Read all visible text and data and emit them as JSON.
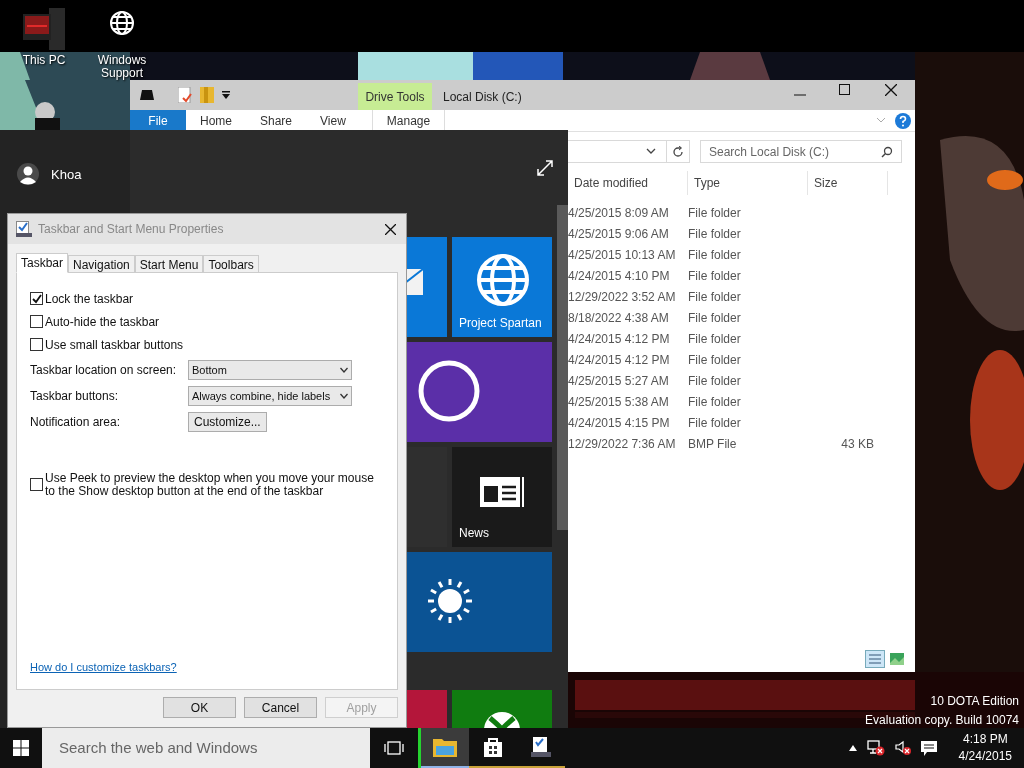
{
  "desktop_icons": [
    {
      "kind": "computer",
      "label": "This PC"
    },
    {
      "kind": "globe",
      "label": "Windows Support"
    }
  ],
  "explorer": {
    "context_tab": "Drive Tools",
    "title": "Local Disk (C:)",
    "ribbon_tabs": [
      {
        "label": "File",
        "selected": true
      },
      {
        "label": "Home",
        "selected": false
      },
      {
        "label": "Share",
        "selected": false
      },
      {
        "label": "View",
        "selected": false
      },
      {
        "label": "Manage",
        "selected": false
      }
    ],
    "search": {
      "placeholder": "Search Local Disk (C:)"
    },
    "columns": [
      "Date modified",
      "Type",
      "Size"
    ],
    "rows": [
      {
        "date": "4/25/2015 8:09 AM",
        "type": "File folder"
      },
      {
        "date": "4/25/2015 9:06 AM",
        "type": "File folder"
      },
      {
        "date": "4/25/2015 10:13 AM",
        "type": "File folder"
      },
      {
        "date": "4/24/2015 4:10 PM",
        "type": "File folder"
      },
      {
        "date": "12/29/2022 3:52 AM",
        "type": "File folder"
      },
      {
        "date": "8/18/2022 4:38 AM",
        "type": "File folder"
      },
      {
        "date": "4/24/2015 4:12 PM",
        "type": "File folder"
      },
      {
        "date": "4/24/2015 4:12 PM",
        "type": "File folder"
      },
      {
        "date": "4/25/2015 5:27 AM",
        "type": "File folder"
      },
      {
        "date": "4/25/2015 5:38 AM",
        "type": "File folder"
      },
      {
        "date": "4/24/2015 4:15 PM",
        "type": "File folder"
      },
      {
        "date": "12/29/2022 7:36 AM",
        "type": "BMP File",
        "size": "43 KB"
      }
    ]
  },
  "start_menu": {
    "user": "Khoa",
    "tiles": [
      {
        "kind": "mail",
        "color": "#0a78d7"
      },
      {
        "kind": "globe",
        "label": "Project Spartan",
        "color": "#0a78d7"
      },
      {
        "kind": "cortana",
        "color": "#5b2fa8"
      },
      {
        "kind": "blank",
        "color": "#2f2f2f"
      },
      {
        "kind": "news",
        "label": "News",
        "color": "#1a1a1a"
      },
      {
        "kind": "weather",
        "color": "#0b5394"
      }
    ],
    "tiles_lower": [
      {
        "kind": "blank",
        "color": "#b4163a"
      },
      {
        "kind": "xbox",
        "color": "#107c10"
      }
    ]
  },
  "dialog": {
    "title": "Taskbar and Start Menu Properties",
    "tabs": [
      {
        "label": "Taskbar",
        "selected": true
      },
      {
        "label": "Navigation",
        "selected": false
      },
      {
        "label": "Start Menu",
        "selected": false
      },
      {
        "label": "Toolbars",
        "selected": false
      }
    ],
    "options": [
      {
        "label": "Lock the taskbar",
        "checked": true
      },
      {
        "label": "Auto-hide the taskbar",
        "checked": false
      },
      {
        "label": "Use small taskbar buttons",
        "checked": false
      }
    ],
    "settings": [
      {
        "kind": "dropdown",
        "label": "Taskbar location on screen:",
        "value": "Bottom"
      },
      {
        "kind": "dropdown",
        "label": "Taskbar buttons:",
        "value": "Always combine, hide labels"
      },
      {
        "kind": "button",
        "label": "Notification area:",
        "value": "Customize..."
      }
    ],
    "peek": {
      "label": "Use Peek to preview the desktop when you move your mouse to the Show desktop button at the end of the taskbar",
      "checked": false
    },
    "help_link": "How do I customize taskbars?",
    "buttons": [
      {
        "label": "OK",
        "disabled": false
      },
      {
        "label": "Cancel",
        "disabled": false
      },
      {
        "label": "Apply",
        "disabled": true
      }
    ]
  },
  "desktop_notice": [
    "10 DOTA Edition",
    "Evaluation copy. Build 10074"
  ],
  "taskbar": {
    "search": {
      "placeholder": "Search the web and Windows"
    },
    "apps": [
      {
        "kind": "explorer",
        "active": true
      },
      {
        "kind": "store",
        "active": false
      },
      {
        "kind": "dialog",
        "active": false
      }
    ],
    "time": "4:18 PM",
    "date": "4/24/2015"
  }
}
